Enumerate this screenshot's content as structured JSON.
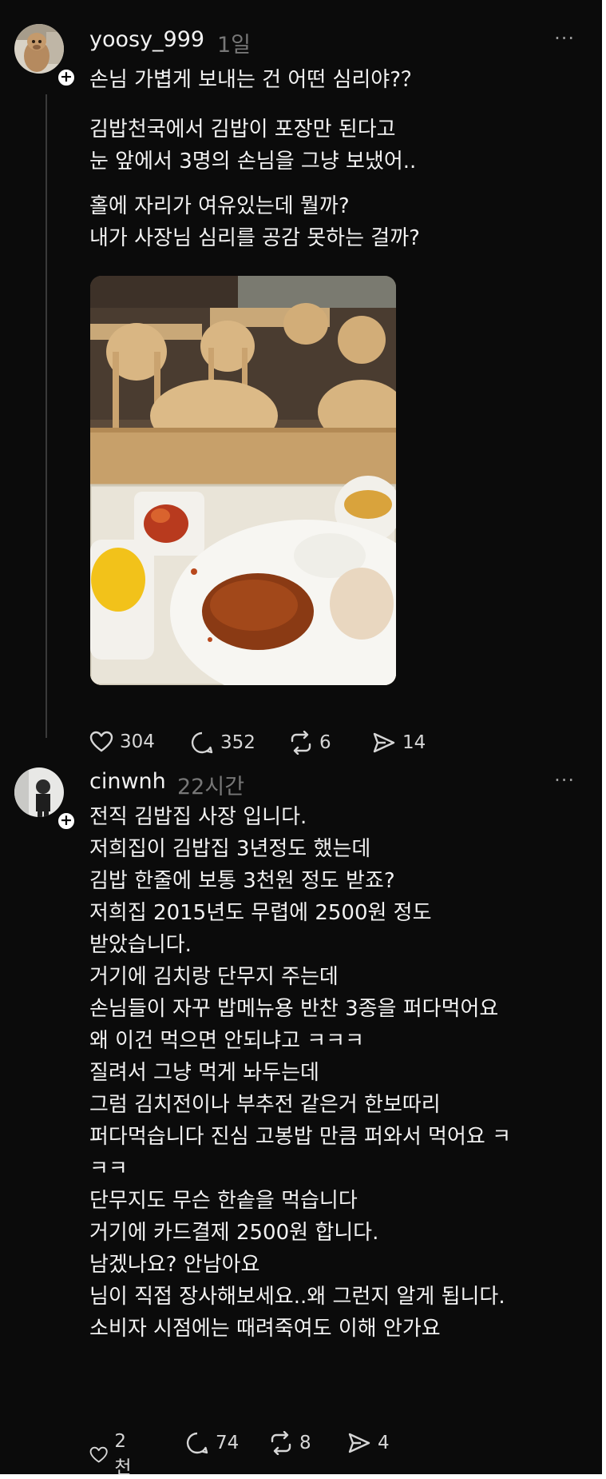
{
  "posts": [
    {
      "username": "yoosy_999",
      "time": "1일",
      "more": "···",
      "lines": [
        "손님 가볍게 보내는 건 어떤 심리야?？",
        "김밥천국에서 김밥이 포장만 된다고",
        "눈 앞에서 3명의 손님을 그냥 보냈어..",
        "홀에 자리가 여유있는데 뭘까?",
        "내가 사장님 심리를 공감 못하는 걸까?"
      ],
      "likes": "304",
      "replies": "352",
      "reposts": "6",
      "shares": "14"
    },
    {
      "username": "cinwnh",
      "time": "22시간",
      "more": "···",
      "lines": [
        "전직 김밥집 사장 입니다.",
        "저희집이 김밥집 3년정도 했는데",
        "김밥 한줄에 보통 3천원 정도 받죠?",
        "저희집 2015년도 무렵에 2500원 정도",
        "받았습니다.",
        "거기에 김치랑 단무지 주는데",
        "손님들이 자꾸 밥메뉴용 반찬 3종을 퍼다먹어요",
        "왜 이건 먹으면 안되냐고 ㅋㅋㅋ",
        "질려서 그냥 먹게 놔두는데",
        "그럼 김치전이나 부추전 같은거 한보따리",
        "퍼다먹습니다 진심 고봉밥 만큼 퍼와서 먹어요 ㅋ",
        "ㅋㅋ",
        "단무지도 무슨 한솥을 먹습니다",
        "거기에 카드결제 2500원 합니다.",
        "남겠나요? 안남아요",
        "님이 직접 장사해보세요..왜 그런지 알게 됩니다.",
        "소비자 시점에는 때려죽여도 이해 안가요"
      ],
      "likes": "2천",
      "replies": "74",
      "reposts": "8",
      "shares": "4"
    }
  ],
  "icons": [
    "plus-icon",
    "more-icon",
    "heart-icon",
    "reply-icon",
    "repost-icon",
    "share-icon"
  ],
  "colors": {
    "background": "#0b0b0b",
    "text": "#f2f2f2",
    "muted": "#777777"
  }
}
